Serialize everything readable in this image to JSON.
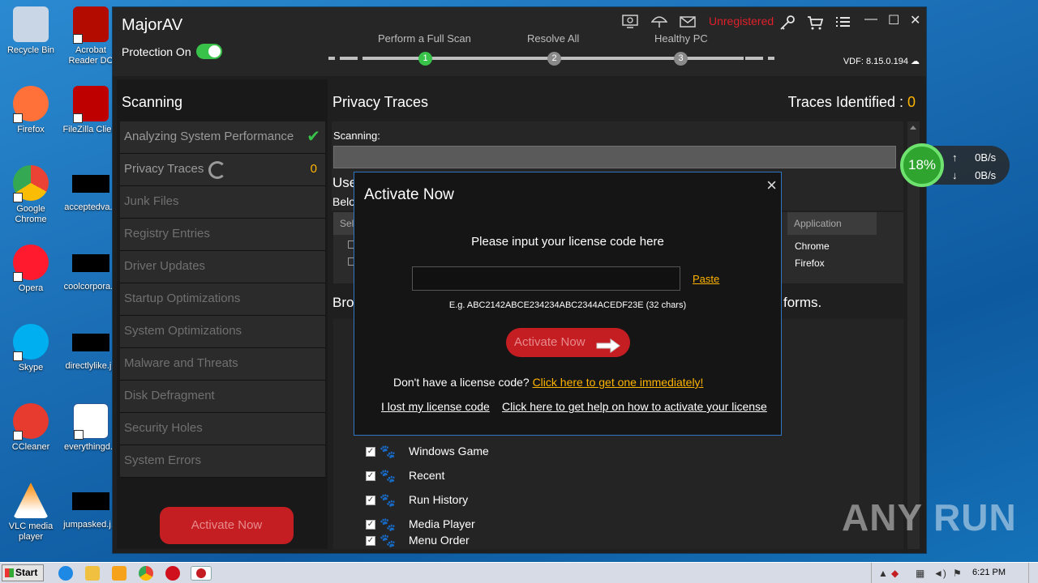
{
  "desktop": {
    "icons": [
      {
        "label": "Recycle Bin",
        "color": "#9fb8d8"
      },
      {
        "label": "Acrobat Reader DC",
        "color": "#b30b00"
      },
      {
        "label": "Firefox",
        "color": "#ff7139"
      },
      {
        "label": "FileZilla Client",
        "color": "#bf0000"
      },
      {
        "label": "Google Chrome",
        "color": "#4285f4"
      },
      {
        "label": "acceptedva...",
        "color": "#000000"
      },
      {
        "label": "Opera",
        "color": "#ff1b2d"
      },
      {
        "label": "coolcorpora...",
        "color": "#000000"
      },
      {
        "label": "Skype",
        "color": "#00aff0"
      },
      {
        "label": "directlylike.jp",
        "color": "#000000"
      },
      {
        "label": "CCleaner",
        "color": "#e63b2e"
      },
      {
        "label": "everythingd...",
        "color": "#2b579a"
      },
      {
        "label": "VLC media player",
        "color": "#ff8800"
      },
      {
        "label": "jumpasked.j...",
        "color": "#000000"
      }
    ]
  },
  "app": {
    "title": "MajorAV",
    "protection_label": "Protection On",
    "steps": [
      {
        "label": "Perform a Full Scan",
        "number": "1",
        "color": "#39c24a"
      },
      {
        "label": "Resolve All",
        "number": "2",
        "color": "#8a8a8a"
      },
      {
        "label": "Healthy PC",
        "number": "3",
        "color": "#8a8a8a"
      }
    ],
    "unregistered": "Unregistered",
    "vdf": "VDF: 8.15.0.194",
    "sidebar": {
      "heading": "Scanning",
      "items": [
        {
          "label": "Analyzing System Performance"
        },
        {
          "label": "Privacy Traces",
          "count": "0"
        },
        {
          "label": "Junk Files"
        },
        {
          "label": "Registry Entries"
        },
        {
          "label": "Driver Updates"
        },
        {
          "label": "Startup Optimizations"
        },
        {
          "label": "System Optimizations"
        },
        {
          "label": "Malware and Threats"
        },
        {
          "label": "Disk Defragment"
        },
        {
          "label": "Security Holes"
        },
        {
          "label": "System Errors"
        }
      ],
      "activate_label": "Activate Now"
    },
    "main": {
      "title": "Privacy Traces",
      "traces_label": "Traces Identified : ",
      "traces_count": "0",
      "scanning_label": "Scanning:",
      "partial_use": "Use",
      "partial_belo": "Belo",
      "partial_bro": "Bro",
      "partial_forms": "forms.",
      "col_sel": "Sel",
      "col_application": "Application",
      "apps": [
        "Chrome",
        "Firefox"
      ],
      "list_items": [
        "Windows Game",
        "Recent",
        "Run History",
        "Media Player",
        "Menu Order"
      ]
    }
  },
  "modal": {
    "title": "Activate Now",
    "prompt": "Please input your license code here",
    "input_value": "",
    "paste_label": "Paste",
    "example": "E.g. ABC2142ABCE234234ABC2344ACEDF23E (32 chars)",
    "activate_label": "Activate Now",
    "no_license_text": "Don't have a license code? ",
    "get_one_link": "Click here to get one immediately!",
    "lost_link": "I lost my license code",
    "help_link": "Click here to get help on how to activate your license"
  },
  "netmon": {
    "percent": "18%",
    "up": "0B/s",
    "down": "0B/s"
  },
  "watermark": "ANY RUN",
  "taskbar": {
    "start_label": "Start",
    "clock": "6:21 PM"
  }
}
